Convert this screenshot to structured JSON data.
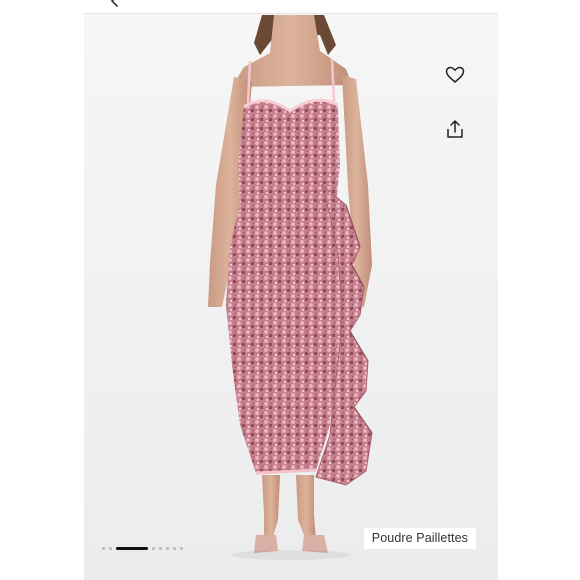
{
  "icons": {
    "back": "chevron-left-icon",
    "favorite": "heart-icon",
    "share": "share-icon"
  },
  "colors": {
    "background": "#f4f4f4",
    "dress": "#c77f8d",
    "sequin_highlight": "#e9b8c1",
    "sequin_shadow": "#8e4b5a",
    "active_indicator": "#111111"
  },
  "carousel": {
    "total_slides": 8,
    "active_index": 2
  },
  "color_label": "Poudre Paillettes"
}
